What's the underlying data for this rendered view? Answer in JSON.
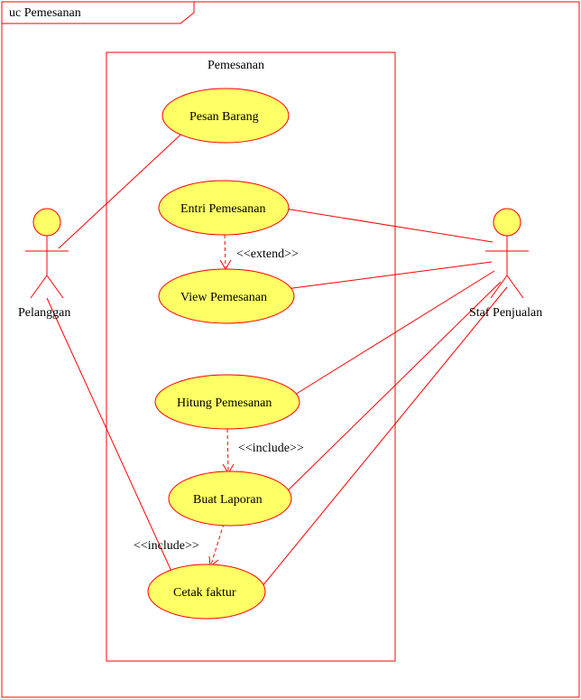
{
  "diagram": {
    "title": "uc Pemesanan",
    "system_name": "Pemesanan",
    "actors": {
      "left": "Pelanggan",
      "right": "Staf Penjualan"
    },
    "usecases": {
      "uc1": "Pesan Barang",
      "uc2": "Entri Pemesanan",
      "uc3": "View Pemesanan",
      "uc4": "Hitung Pemesanan",
      "uc5": "Buat Laporan",
      "uc6": "Cetak faktur"
    },
    "stereotypes": {
      "extend": "<<extend>>",
      "include1": "<<include>>",
      "include2": "<<include>>"
    }
  },
  "chart_data": {
    "type": "use_case_diagram",
    "title": "uc Pemesanan",
    "system_boundary": "Pemesanan",
    "actors": [
      {
        "name": "Pelanggan",
        "side": "left"
      },
      {
        "name": "Staf Penjualan",
        "side": "right"
      }
    ],
    "use_cases": [
      "Pesan Barang",
      "Entri Pemesanan",
      "View Pemesanan",
      "Hitung Pemesanan",
      "Buat Laporan",
      "Cetak faktur"
    ],
    "associations": [
      {
        "actor": "Pelanggan",
        "use_case": "Pesan Barang"
      },
      {
        "actor": "Pelanggan",
        "use_case": "Cetak faktur"
      },
      {
        "actor": "Staf Penjualan",
        "use_case": "Entri Pemesanan"
      },
      {
        "actor": "Staf Penjualan",
        "use_case": "View Pemesanan"
      },
      {
        "actor": "Staf Penjualan",
        "use_case": "Hitung Pemesanan"
      },
      {
        "actor": "Staf Penjualan",
        "use_case": "Buat Laporan"
      },
      {
        "actor": "Staf Penjualan",
        "use_case": "Cetak faktur"
      }
    ],
    "dependencies": [
      {
        "from": "Entri Pemesanan",
        "to": "View Pemesanan",
        "stereotype": "<<extend>>"
      },
      {
        "from": "Hitung Pemesanan",
        "to": "Buat Laporan",
        "stereotype": "<<include>>"
      },
      {
        "from": "Buat Laporan",
        "to": "Cetak faktur",
        "stereotype": "<<include>>"
      }
    ]
  }
}
